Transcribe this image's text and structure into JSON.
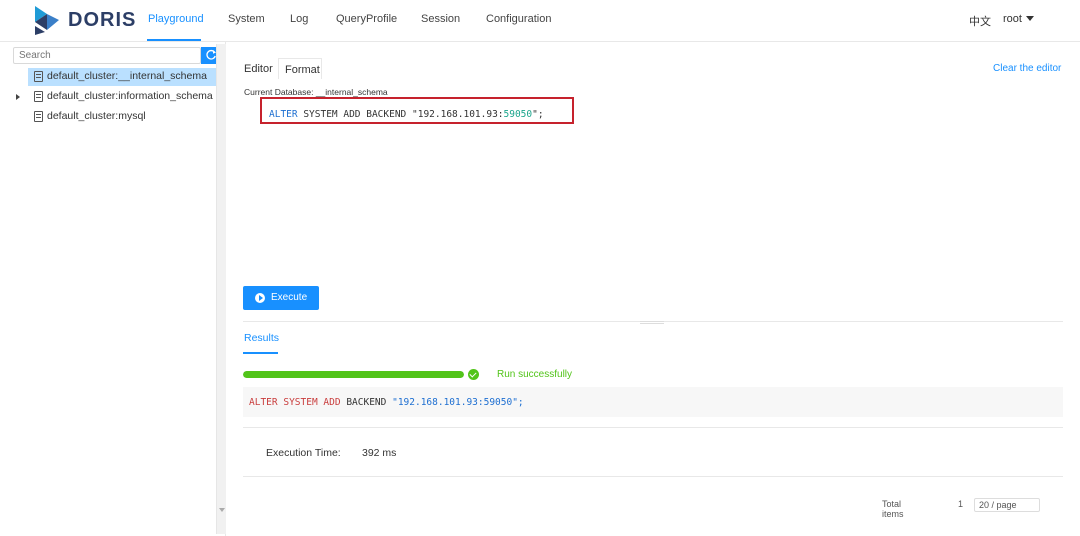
{
  "brand": {
    "name": "DORIS"
  },
  "nav": {
    "items": [
      {
        "label": "Playground",
        "active": true
      },
      {
        "label": "System",
        "active": false
      },
      {
        "label": "Log",
        "active": false
      },
      {
        "label": "QueryProfile",
        "active": false
      },
      {
        "label": "Session",
        "active": false
      },
      {
        "label": "Configuration",
        "active": false
      }
    ],
    "language": "中文",
    "user": "root"
  },
  "sidebar": {
    "search_placeholder": "Search",
    "databases": [
      {
        "label": "default_cluster:__internal_schema",
        "selected": true,
        "expandable": false
      },
      {
        "label": "default_cluster:information_schema",
        "selected": false,
        "expandable": true
      },
      {
        "label": "default_cluster:mysql",
        "selected": false,
        "expandable": false
      }
    ]
  },
  "editor": {
    "tab_editor": "Editor",
    "tab_format": "Format",
    "clear_label": "Clear the editor",
    "current_database_label": "Current Database:",
    "current_database": "__internal_schema",
    "sql": {
      "kw1": "ALTER",
      "rest1": " SYSTEM ADD BACKEND ",
      "str_open": "\"192.168.101.93:",
      "port": "59050",
      "str_close": "\";"
    },
    "execute_label": "Execute"
  },
  "results": {
    "tab_label": "Results",
    "progress": 1.0,
    "status": "Run successfully",
    "sql": {
      "kw1": "ALTER",
      "kw2": "SYSTEM",
      "kw3": "ADD",
      "kw4": "BACKEND",
      "literal": "\"192.168.101.93:59050\";"
    },
    "execution_time_label": "Execution Time:",
    "execution_time_value": "392 ms",
    "pager": {
      "total": "Total items",
      "page": "1",
      "size": "20 / page"
    }
  },
  "colors": {
    "accent": "#1890ff",
    "success": "#52c41a",
    "highlight_border": "#c6222d"
  }
}
